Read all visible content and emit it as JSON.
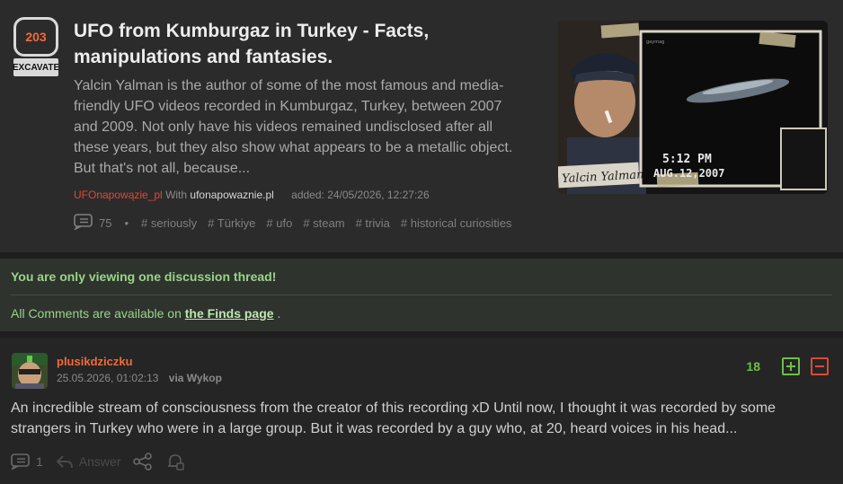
{
  "article": {
    "vote_count": "203",
    "vote_label": "EXCAVATE",
    "title": "UFO from Kumburgaz in Turkey - Facts, manipulations and fantasies.",
    "description": "Yalcin Yalman is the author of some of the most famous and media-friendly UFO videos recorded in Kumburgaz, Turkey, between 2007 and 2009. Not only have his videos remained undisclosed after all these years, but they also show what appears to be a metallic object. But that's not all, because...",
    "author": "UFOnapowązie_pl",
    "with_label": "With",
    "domain": "ufonapowaznie.pl",
    "added": "added: 24/05/2026, 12:27:26",
    "comment_count": "75",
    "tags": [
      "# seriously",
      "# Türkiye",
      "# ufo",
      "# steam",
      "# trivia",
      "# historical curiosities"
    ],
    "thumbnail": {
      "name_text": "Yalcin Yalman",
      "time_text": "5:12 PM",
      "date_text": "AUG.12,2007",
      "small_caption": "gaymag"
    }
  },
  "notice": {
    "message": "You are only viewing one discussion thread!",
    "all_comments_prefix": "All Comments are available on",
    "finds_link": "the Finds page",
    "suffix": "."
  },
  "comment": {
    "username": "plusikdziczku",
    "date": "25.05.2026, 01:02:13",
    "via": "via Wykop",
    "score": "18",
    "text": "An incredible stream of consciousness from the creator of this recording xD Until now, I thought it was recorded by some strangers in Turkey who were in a large group. But it was recorded by a guy who, at 20, heard voices in his head...",
    "reply_count": "1",
    "answer_label": "Answer"
  },
  "colors": {
    "accent_orange": "#f26a38",
    "author_red": "#e04836",
    "notice_green": "#9bd38a",
    "plus_green": "#6cbf48"
  }
}
